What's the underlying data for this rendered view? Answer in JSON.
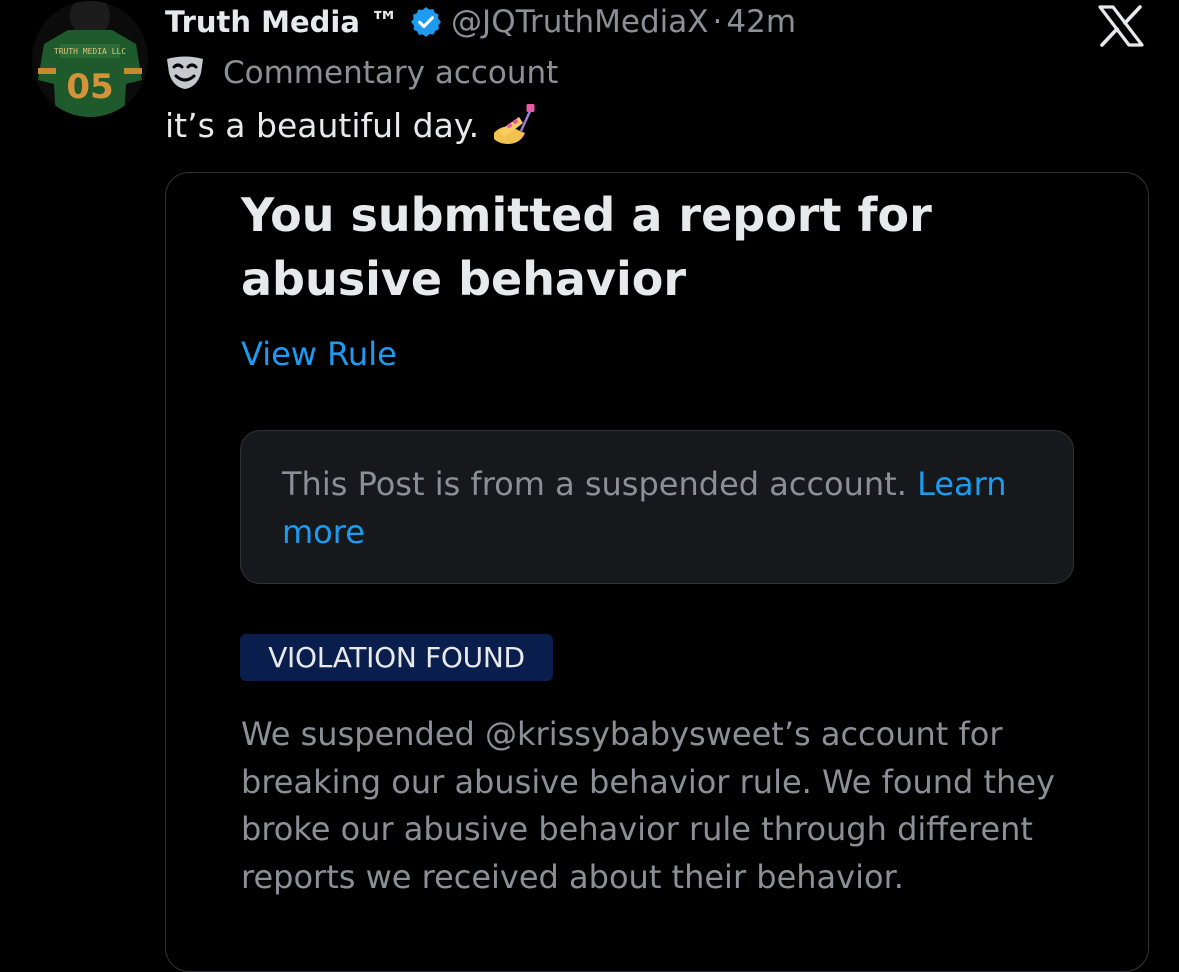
{
  "post": {
    "display_name": "Truth Media ™",
    "handle": "@JQTruthMediaX",
    "separator": "·",
    "time": "42m",
    "account_label": "Commentary account",
    "text": "it’s a beautiful day.",
    "avatar": {
      "jersey_text": "TRUTH MEDIA LLC",
      "jersey_number": "05"
    }
  },
  "card": {
    "title": "You submitted a report for abusive behavior",
    "view_rule_link": "View Rule",
    "notice": {
      "text": "This Post is from a suspended account.",
      "link": "Learn more"
    },
    "status_badge": "VIOLATION FOUND",
    "explanation": "We suspended @krissybabysweet’s account for breaking our abusive behavior rule. We found they broke our abusive behavior rule through different reports we received about their behavior."
  },
  "icons": {
    "verified": "verified-badge-icon",
    "label": "theater-mask-icon",
    "emoji": "nail-polish-emoji-icon",
    "brand": "x-logo-icon"
  },
  "colors": {
    "background": "#000000",
    "primary_text": "#e7e9ea",
    "secondary_text": "#8b9096",
    "link": "#1d9bf0",
    "verified": "#1d9bf0",
    "badge_background": "#0a1e4e",
    "notice_background": "#16181c",
    "border": "#2f3336"
  }
}
